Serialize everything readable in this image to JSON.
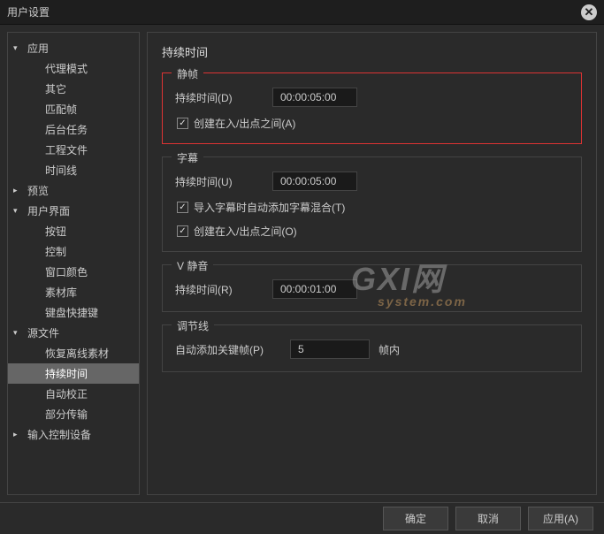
{
  "title": "用户设置",
  "sidebar": {
    "items": [
      {
        "label": "应用",
        "expanded": true,
        "children": [
          "代理模式",
          "其它",
          "匹配帧",
          "后台任务",
          "工程文件",
          "时间线"
        ]
      },
      {
        "label": "预览",
        "expanded": false,
        "children": []
      },
      {
        "label": "用户界面",
        "expanded": true,
        "children": [
          "按钮",
          "控制",
          "窗口颜色",
          "素材库",
          "键盘快捷键"
        ]
      },
      {
        "label": "源文件",
        "expanded": true,
        "children": [
          "恢复离线素材",
          "持续时间",
          "自动校正",
          "部分传输"
        ]
      },
      {
        "label": "输入控制设备",
        "expanded": false,
        "children": []
      }
    ],
    "active": "持续时间"
  },
  "content": {
    "title": "持续时间",
    "still": {
      "label": "静帧",
      "duration_label": "持续时间(D)",
      "duration_value": "00:00:05:00",
      "checkbox_label": "创建在入/出点之间(A)",
      "checkbox_checked": true
    },
    "subtitle": {
      "label": "字幕",
      "duration_label": "持续时间(U)",
      "duration_value": "00:00:05:00",
      "check1_label": "导入字幕时自动添加字幕混合(T)",
      "check1_checked": true,
      "check2_label": "创建在入/出点之间(O)",
      "check2_checked": true
    },
    "vmute": {
      "label": "V 静音",
      "duration_label": "持续时间(R)",
      "duration_value": "00:00:01:00"
    },
    "rubber": {
      "label": "调节线",
      "keyframe_label": "自动添加关键帧(P)",
      "keyframe_value": "5",
      "suffix": "帧内"
    }
  },
  "footer": {
    "ok": "确定",
    "cancel": "取消",
    "apply": "应用(A)"
  },
  "watermark": {
    "main": "GXI网",
    "sub": "system.com"
  }
}
